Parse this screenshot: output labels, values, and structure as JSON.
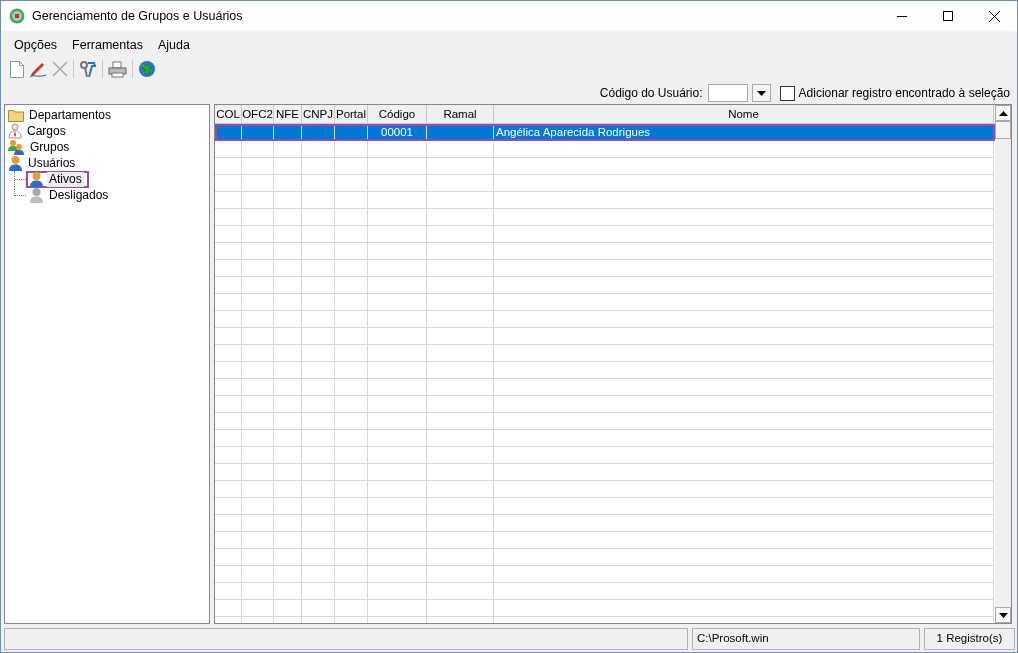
{
  "window": {
    "title": "Gerenciamento de Grupos e Usuários"
  },
  "menu": [
    "Opções",
    "Ferramentas",
    "Ajuda"
  ],
  "toolbar": [
    {
      "kind": "new",
      "disabled": false
    },
    {
      "kind": "edit",
      "disabled": false
    },
    {
      "kind": "delete",
      "disabled": true
    },
    {
      "kind": "separator"
    },
    {
      "kind": "tools",
      "disabled": false
    },
    {
      "kind": "separator"
    },
    {
      "kind": "print",
      "disabled": false
    },
    {
      "kind": "separator"
    },
    {
      "kind": "update",
      "disabled": false
    }
  ],
  "search": {
    "label": "Código do Usuário:",
    "checkbox": {
      "label": "Adicionar registro encontrado à seleção",
      "checked": false
    }
  },
  "tree": [
    {
      "label": "Departamentos",
      "kind": "folder",
      "selected": false
    },
    {
      "label": "Cargos",
      "kind": "role",
      "selected": false
    },
    {
      "label": "Grupos",
      "kind": "group",
      "selected": false
    },
    {
      "label": "Usuários",
      "kind": "user",
      "selected": false,
      "children": [
        {
          "label": "Ativos",
          "kind": "user",
          "selected": true,
          "highlighted": true
        },
        {
          "label": "Desligados",
          "kind": "user-inactive",
          "selected": false,
          "highlighted": false
        }
      ]
    }
  ],
  "table": {
    "columns": [
      "COL",
      "OFC2",
      "NFE",
      "CNPJ",
      "Portal",
      "Código",
      "Ramal",
      "Nome"
    ],
    "rows": [
      {
        "cells": [
          null,
          null,
          null,
          null,
          null,
          "00001",
          null,
          "Angélica Aparecida Rodrigues"
        ],
        "selected": true,
        "highlighted": true
      }
    ]
  },
  "status_bar": [
    "C:\\Prosoft.win",
    "1 Registro(s)"
  ]
}
